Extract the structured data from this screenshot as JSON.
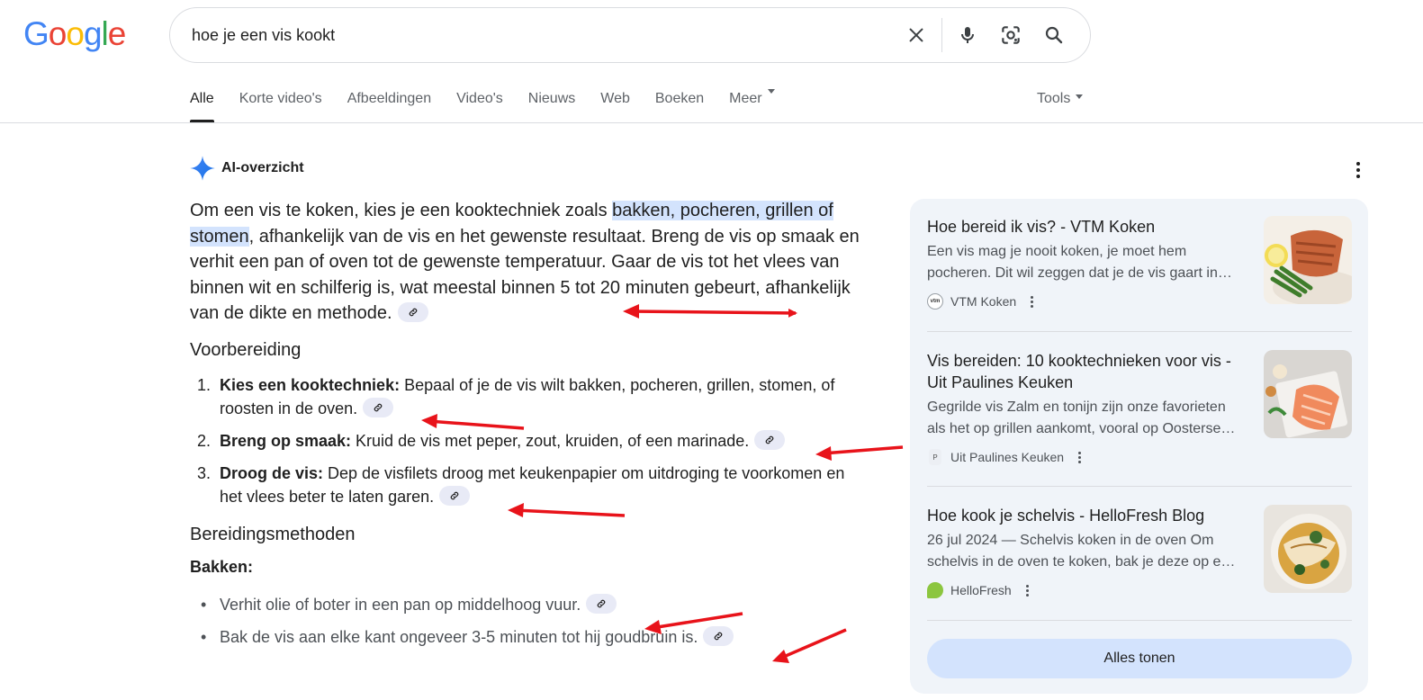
{
  "logo": {
    "letters": [
      "G",
      "o",
      "o",
      "g",
      "l",
      "e"
    ],
    "colors": [
      "#4285f4",
      "#ea4335",
      "#fbbc05",
      "#4285f4",
      "#34a853",
      "#ea4335"
    ]
  },
  "search": {
    "query": "hoe je een vis kookt"
  },
  "tabs": [
    {
      "label": "Alle",
      "active": true
    },
    {
      "label": "Korte video's"
    },
    {
      "label": "Afbeeldingen"
    },
    {
      "label": "Video's"
    },
    {
      "label": "Nieuws"
    },
    {
      "label": "Web"
    },
    {
      "label": "Boeken"
    },
    {
      "label": "Meer",
      "dropdown": true
    }
  ],
  "tools_label": "Tools",
  "ai_overview": {
    "title": "AI-overzicht",
    "intro_before": "Om een vis te koken, kies je een kooktechniek zoals ",
    "intro_highlight": "bakken, pocheren, grillen of stomen",
    "intro_after": ", afhankelijk van de vis en het gewenste resultaat. Breng de vis op smaak en verhit een pan of oven tot de gewenste temperatuur. Gaar de vis tot het vlees van binnen wit en schilferig is, wat meestal binnen 5 tot 20 minuten gebeurt, afhankelijk van de dikte en methode.",
    "section1_title": "Voorbereiding",
    "steps": [
      {
        "num": "1.",
        "bold": "Kies een kooktechniek:",
        "text": " Bepaal of je de vis wilt bakken, pocheren, grillen, stomen, of roosten in de oven."
      },
      {
        "num": "2.",
        "bold": "Breng op smaak:",
        "text": " Kruid de vis met peper, zout, kruiden, of een marinade."
      },
      {
        "num": "3.",
        "bold": "Droog de vis:",
        "text": " Dep de visfilets droog met keukenpapier om uitdroging te voorkomen en het vlees beter te laten garen."
      }
    ],
    "section2_title": "Bereidingsmethoden",
    "method_label": "Bakken:",
    "methods": [
      "Verhit olie of boter in een pan op middelhoog vuur.",
      "Bak de vis aan elke kant ongeveer 3-5 minuten tot hij goudbruin is."
    ]
  },
  "sources": [
    {
      "title": "Hoe bereid ik vis? - VTM Koken",
      "snippet_line1": "Een vis mag je nooit koken, je moet hem",
      "snippet_line2": "pocheren. Dit wil zeggen dat je de vis gaart in…",
      "site": "VTM Koken",
      "thumb_icon": "salmon-fillet-photo"
    },
    {
      "title": "Vis bereiden: 10 kooktechnieken voor vis - Uit Paulines Keuken",
      "snippet_line1": "Gegrilde vis Zalm en tonijn zijn onze favorieten",
      "snippet_line2": "als het op grillen aankomt, vooral op Oosterse…",
      "site": "Uit Paulines Keuken",
      "thumb_icon": "raw-salmon-photo"
    },
    {
      "title": "Hoe kook je schelvis - HelloFresh Blog",
      "snippet_line1": "26 jul 2024 — Schelvis koken in de oven Om",
      "snippet_line2": "schelvis in de oven te koken, bak je deze op e…",
      "site": "HelloFresh",
      "thumb_icon": "haddock-dish-photo"
    }
  ],
  "show_all_label": "Alles tonen",
  "accent_colors": {
    "highlight": "#d3e3fd",
    "panel": "#f0f4f9",
    "arrow": "#e8131a"
  }
}
